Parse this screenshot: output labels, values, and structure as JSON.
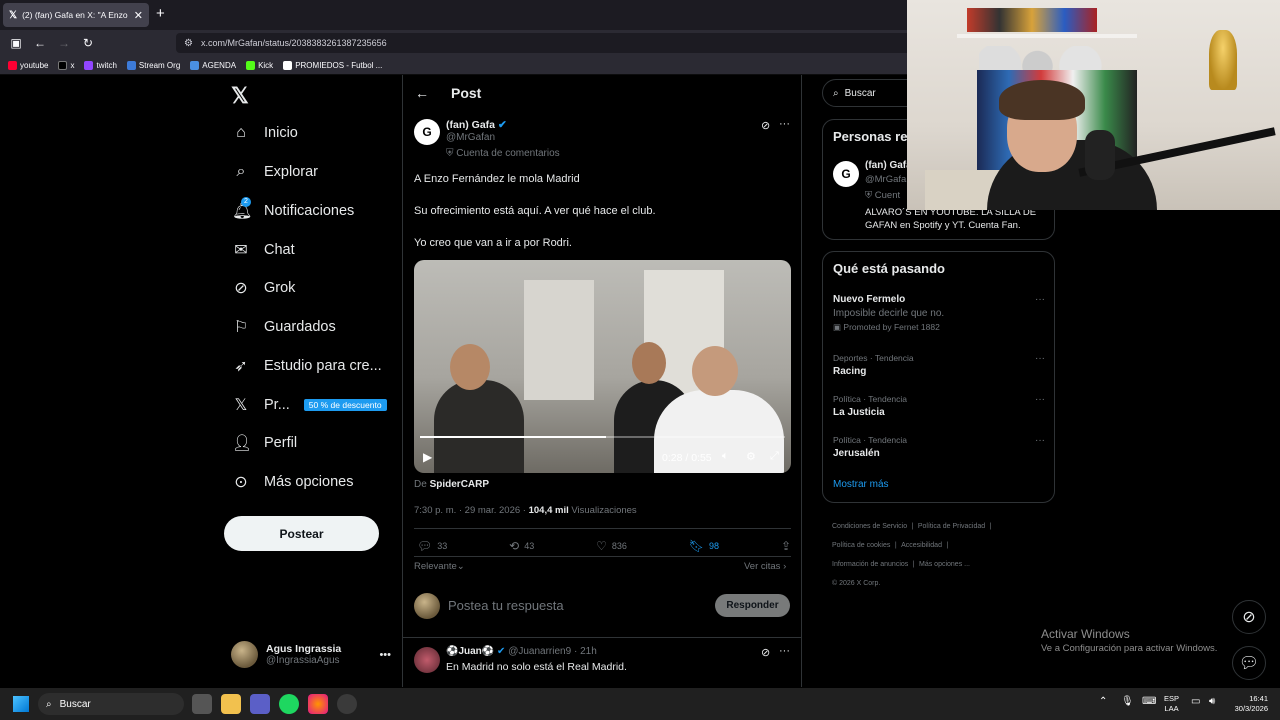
{
  "browser": {
    "tab_title": "(2) (fan) Gafa en X: \"A Enzo Fern",
    "url": "x.com/MrGafan/status/2038383261387235656",
    "bookmarks": [
      "youtube",
      "x",
      "twitch",
      "Stream Org",
      "AGENDA",
      "Kick",
      "PROMIEDOS - Futbol ..."
    ]
  },
  "leftnav": {
    "items": [
      {
        "label": "Inicio",
        "icon": "home-icon"
      },
      {
        "label": "Explorar",
        "icon": "search-icon"
      },
      {
        "label": "Notificaciones",
        "icon": "bell-icon",
        "count": "2"
      },
      {
        "label": "Chat",
        "icon": "mail-icon"
      },
      {
        "label": "Grok",
        "icon": "grok-icon"
      },
      {
        "label": "Guardados",
        "icon": "bookmark-icon"
      },
      {
        "label": "Estudio para cre...",
        "icon": "rocket-icon"
      },
      {
        "label": "Pr...",
        "icon": "x-logo-icon",
        "badge": "50 % de descuento"
      },
      {
        "label": "Perfil",
        "icon": "person-icon"
      },
      {
        "label": "Más opciones",
        "icon": "more-circle-icon"
      }
    ],
    "post_button": "Postear",
    "profile": {
      "name": "Agus Ingrassia",
      "handle": "@IngrassiaAgus"
    }
  },
  "post": {
    "header": "Post",
    "author_name": "(fan) Gafa",
    "author_handle": "@MrGafan",
    "account_note": "Cuenta de comentarios",
    "lines": [
      "A Enzo Fernández le mola Madrid",
      "Su ofrecimiento está aquí. A ver qué hace el club.",
      "Yo creo que van a ir a por Rodri."
    ],
    "video_time": "0:28 / 0:55",
    "video_progress": 0.51,
    "from_prefix": "De",
    "from_user": "SpiderCARP",
    "timestamp": "7:30 p. m. · 29 mar. 2026 ·",
    "views": "104,4 mil",
    "views_label": "Visualizaciones",
    "replies": "33",
    "reposts": "43",
    "likes": "836",
    "bookmarks": "98",
    "sort": "Relevante",
    "quotes": "Ver citas",
    "reply_placeholder": "Postea tu respuesta",
    "reply_button": "Responder"
  },
  "reply": {
    "name": "Juan",
    "handle": "@Juanarrien9",
    "time": "21h",
    "text": "En Madrid no solo está el Real Madrid."
  },
  "right": {
    "search_placeholder": "Buscar",
    "people_title": "Personas re",
    "person_name": "(fan) Gafa",
    "person_handle": "@MrGafa",
    "person_note": "Cuent",
    "person_bio": "ALVARO´S EN YOUTUBE. LA SILLA DE GAFAN en Spotify y YT. Cuenta Fan.",
    "trending_title": "Qué está pasando",
    "trends": [
      {
        "title": "Nuevo Fermelo",
        "sub": "Imposible decirle que no.",
        "promo": "Promoted by Fernet 1882"
      },
      {
        "category": "Deportes · Tendencia",
        "title": "Racing"
      },
      {
        "category": "Política · Tendencia",
        "title": "La Justicia"
      },
      {
        "category": "Política · Tendencia",
        "title": "Jerusalén"
      }
    ],
    "show_more": "Mostrar más",
    "footer": [
      "Condiciones de Servicio",
      "Política de Privacidad",
      "Política de cookies",
      "Accesibilidad",
      "Información de anuncios",
      "Más opciones ...",
      "© 2026 X Corp."
    ]
  },
  "windows": {
    "activate_title": "Activar Windows",
    "activate_sub": "Ve a Configuración para activar Windows.",
    "search": "Buscar",
    "lang1": "ESP",
    "lang2": "LAA",
    "time": "16:41",
    "date": "30/3/2026"
  }
}
